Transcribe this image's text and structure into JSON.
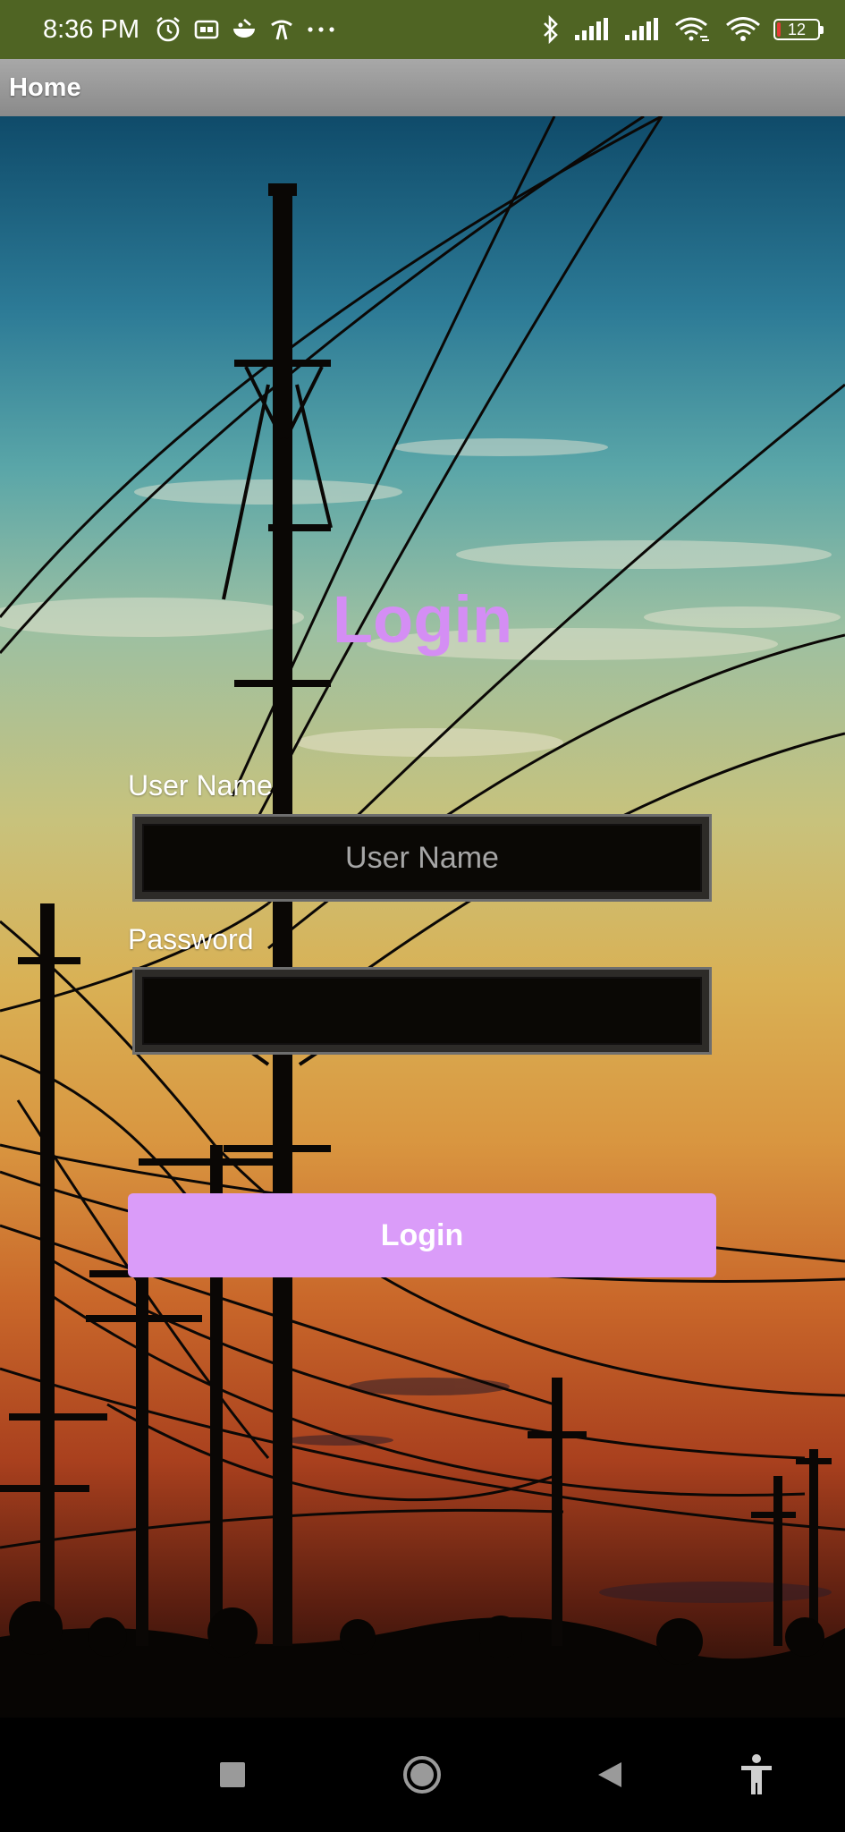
{
  "status_bar": {
    "time": "8:36 PM",
    "left_icons": [
      "alarm-icon",
      "message-icon",
      "bowl-icon",
      "call-icon",
      "more-dots-icon"
    ],
    "right_icons": [
      "bluetooth-icon",
      "signal-icon",
      "signal-icon",
      "wifi-link-icon",
      "wifi-icon"
    ],
    "battery_level": "12",
    "color": "#4f6423"
  },
  "app_bar": {
    "title": "Home"
  },
  "login": {
    "title": "Login",
    "title_color": "#d48ef4",
    "username": {
      "label": "User Name",
      "placeholder": "User Name",
      "value": ""
    },
    "password": {
      "label": "Password",
      "placeholder": "",
      "value": ""
    },
    "button_label": "Login",
    "button_color": "#da9cf9"
  },
  "nav_bar": {
    "items": [
      "recents-square-icon",
      "home-circle-icon",
      "back-triangle-icon",
      "accessibility-icon"
    ]
  }
}
